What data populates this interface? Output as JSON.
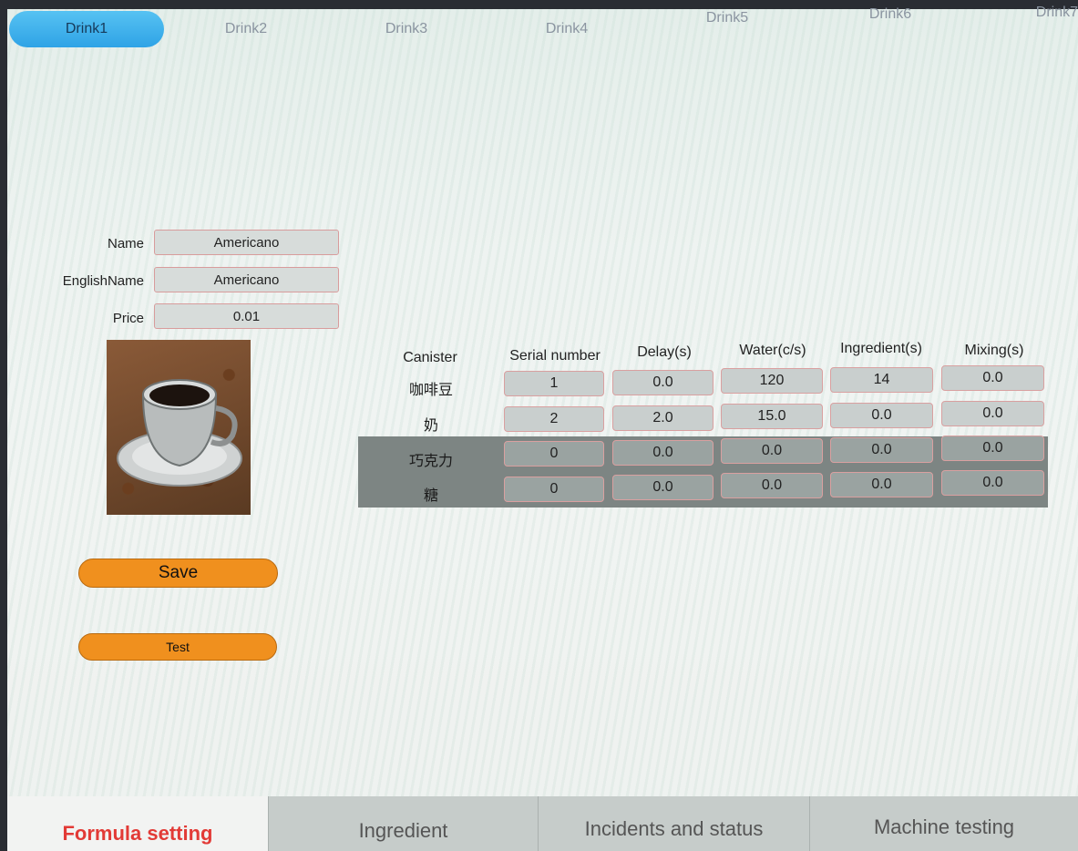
{
  "tabs": [
    "Drink1",
    "Drink2",
    "Drink3",
    "Drink4",
    "Drink5",
    "Drink6",
    "Drink7"
  ],
  "form": {
    "name_label": "Name",
    "name_value": "Americano",
    "english_name_label": "EnglishName",
    "english_name_value": "Americano",
    "price_label": "Price",
    "price_value": "0.01"
  },
  "buttons": {
    "save": "Save",
    "test": "Test"
  },
  "table": {
    "headers": [
      "Canister",
      "Serial number",
      "Delay(s)",
      "Water(c/s)",
      "Ingredient(s)",
      "Mixing(s)"
    ],
    "rows": [
      {
        "canister": "咖啡豆",
        "serial": "1",
        "delay": "0.0",
        "water": "120",
        "ingredient": "14",
        "mixing": "0.0"
      },
      {
        "canister": "奶",
        "serial": "2",
        "delay": "2.0",
        "water": "15.0",
        "ingredient": "0.0",
        "mixing": "0.0"
      },
      {
        "canister": "巧克力",
        "serial": "0",
        "delay": "0.0",
        "water": "0.0",
        "ingredient": "0.0",
        "mixing": "0.0"
      },
      {
        "canister": "糖",
        "serial": "0",
        "delay": "0.0",
        "water": "0.0",
        "ingredient": "0.0",
        "mixing": "0.0"
      }
    ]
  },
  "bottom_tabs": [
    "Formula setting",
    "Ingredient",
    "Incidents and status",
    "Machine testing"
  ],
  "colors": {
    "active_tab": "#2fa3e6",
    "button": "#f0901e",
    "active_bottom_text": "#e23a36"
  }
}
